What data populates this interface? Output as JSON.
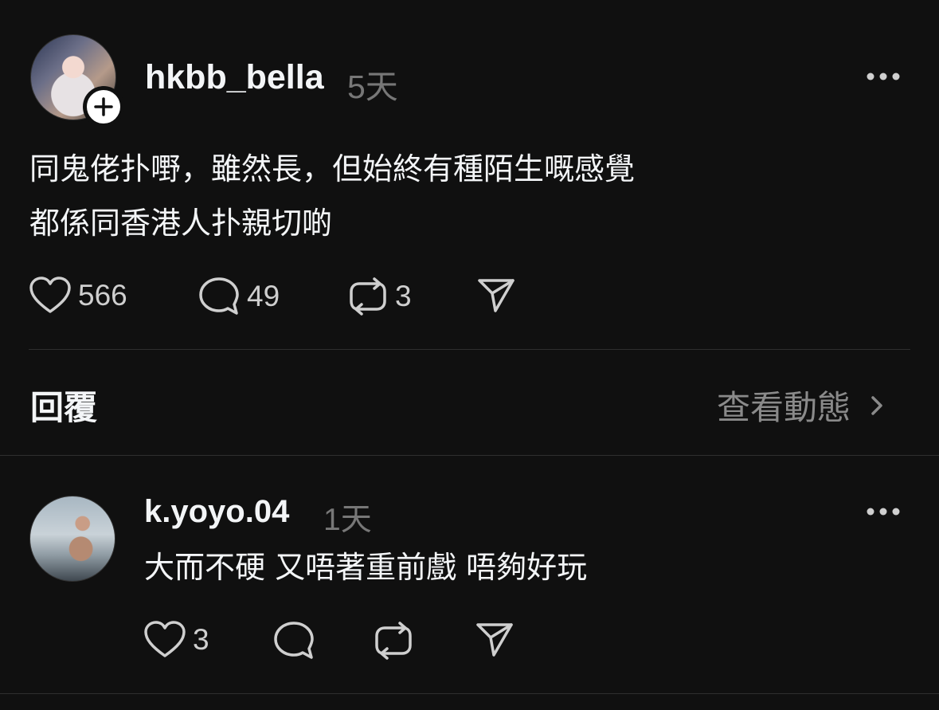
{
  "post": {
    "username": "hkbb_bella",
    "time": "5天",
    "lines": [
      "同鬼佬扑嘢，雖然長，但始終有種陌生嘅感覺",
      "都係同香港人扑親切啲"
    ],
    "likes": "566",
    "comments": "49",
    "reposts": "3"
  },
  "replies_header": {
    "label": "回覆",
    "activity_label": "查看動態"
  },
  "reply": {
    "username": "k.yoyo.04",
    "time": "1天",
    "text": "大而不硬 又唔著重前戲 唔夠好玩",
    "likes": "3"
  },
  "icons": {
    "like": "heart-icon",
    "comment": "comment-bubble-icon",
    "repost": "repost-icon",
    "share": "send-icon",
    "more": "more-dots-icon",
    "follow": "plus-icon",
    "chevron": "chevron-right-icon"
  }
}
